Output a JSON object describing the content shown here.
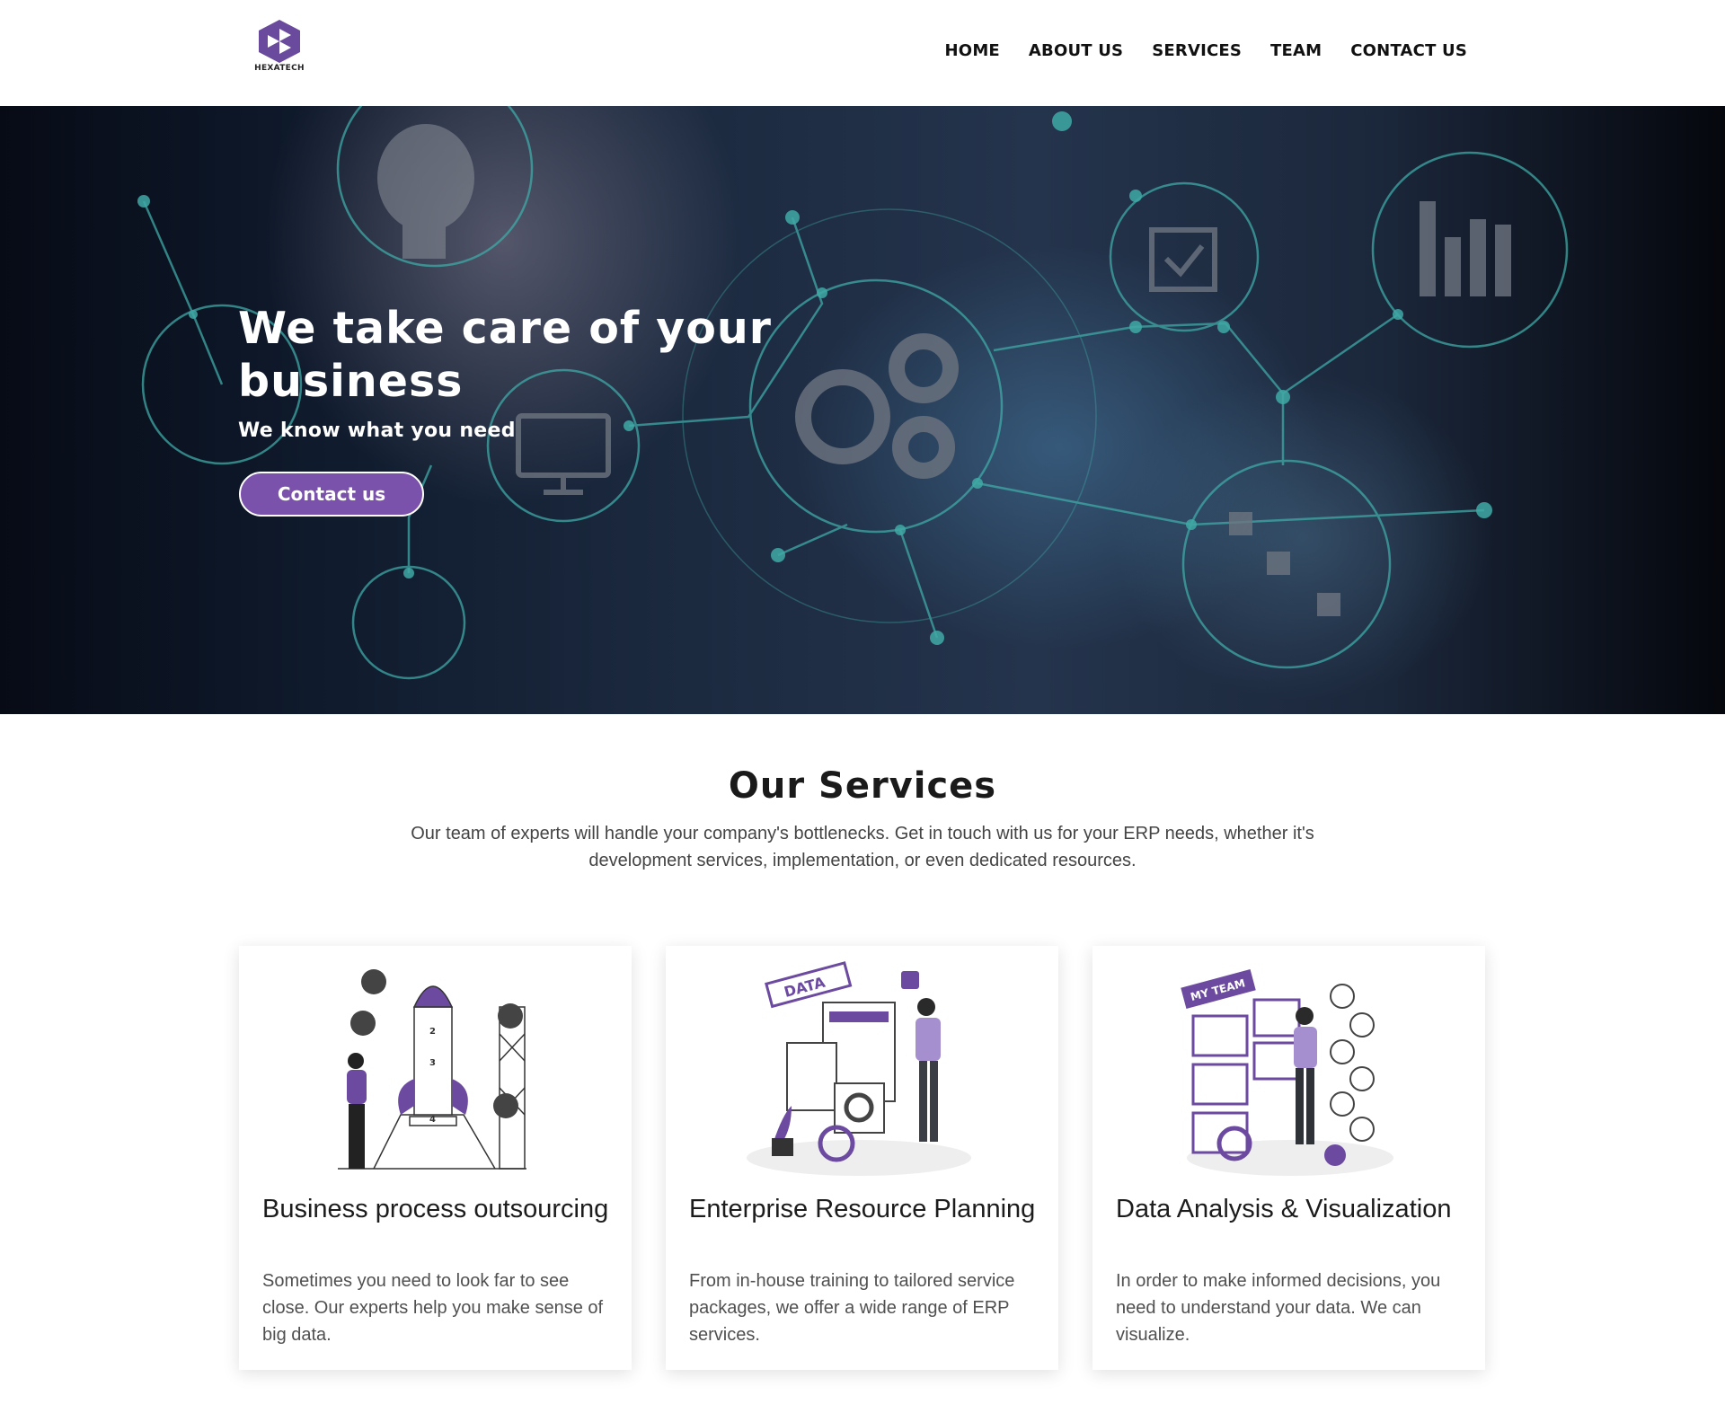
{
  "brand": {
    "name": "HEXATECH",
    "logo_color": "#6a4a9c"
  },
  "nav": {
    "items": [
      {
        "label": "HOME"
      },
      {
        "label": "ABOUT US"
      },
      {
        "label": "SERVICES"
      },
      {
        "label": "TEAM"
      },
      {
        "label": "CONTACT US"
      }
    ]
  },
  "hero": {
    "title": "We take care of your business",
    "subtitle": "We know what you need",
    "cta_label": "Contact us",
    "accent_color": "#7b52ab"
  },
  "services": {
    "title": "Our Services",
    "intro": "Our team of experts will handle your company's bottlenecks. Get in touch with us for your ERP needs, whether it's development services, implementation, or even dedicated resources.",
    "cards": [
      {
        "title": "Business process outsourcing",
        "text": "Sometimes you need to look far to see close. Our experts help you make sense of big data.",
        "illustration": "rocket-launch-illustration"
      },
      {
        "title": "Enterprise Resource Planning",
        "text": "From in-house training to tailored service packages, we offer a wide range of ERP services.",
        "illustration": "data-dashboard-illustration",
        "illus_label": "DATA"
      },
      {
        "title": "Data Analysis & Visualization",
        "text": "In order to make informed decisions, you need to understand your data. We can visualize.",
        "illustration": "team-profiles-illustration",
        "illus_label": "MY TEAM"
      }
    ]
  }
}
